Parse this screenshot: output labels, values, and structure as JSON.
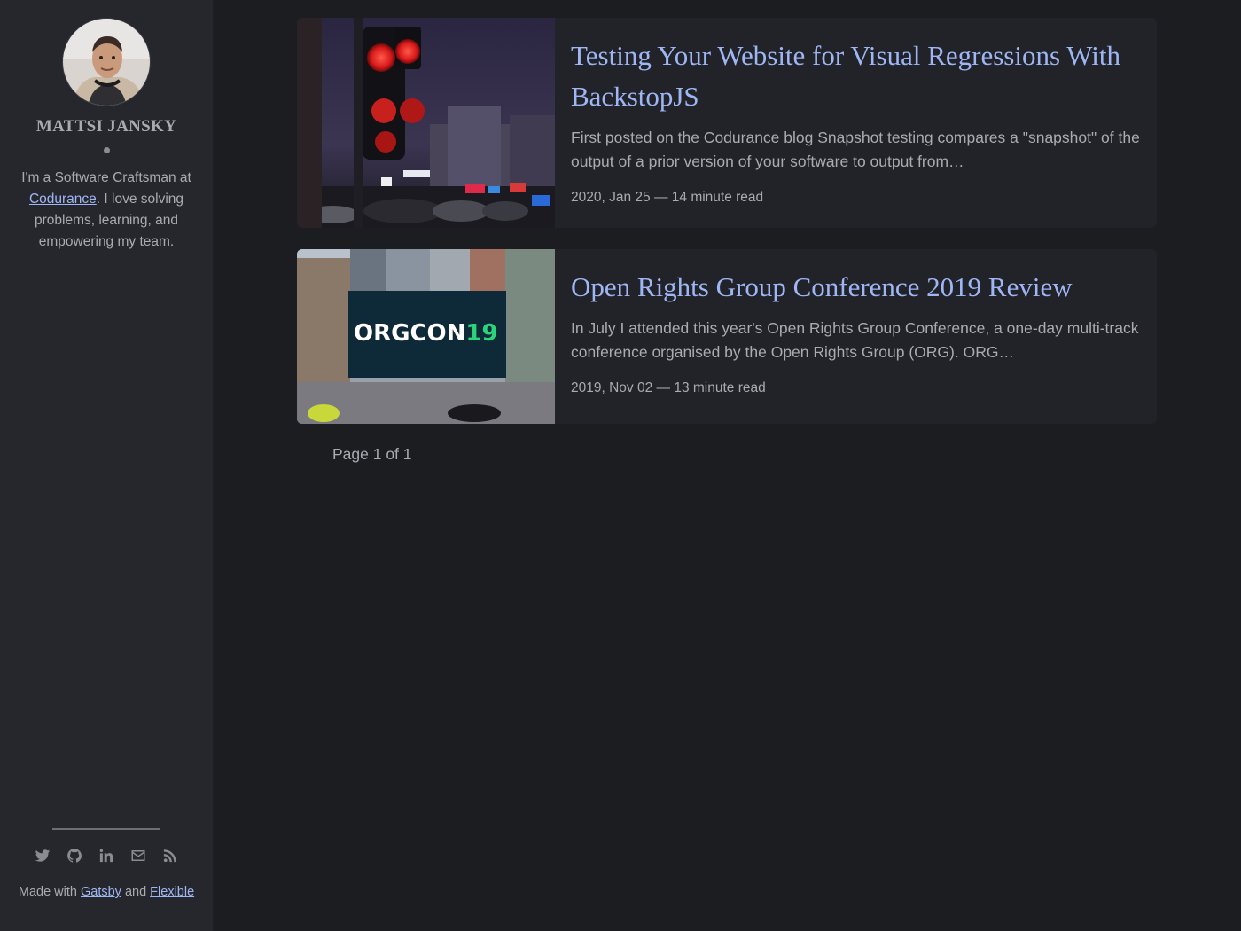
{
  "sidebar": {
    "author_name": "Mattsi Jansky",
    "bio_prefix": "I'm a Software Craftsman at ",
    "bio_link": "Codurance",
    "bio_suffix": ". I love solving problems, learning, and empowering my team.",
    "social_icons": [
      "twitter-icon",
      "github-icon",
      "linkedin-icon",
      "mail-icon",
      "rss-icon"
    ],
    "made_with_prefix": "Made with ",
    "gatsby_label": "Gatsby",
    "and_label": " and ",
    "flexible_label": "Flexible"
  },
  "posts": [
    {
      "title": "Testing Your Website for Visual Regressions With BackstopJS",
      "excerpt": "First posted on the Codurance blog Snapshot testing compares a \"snapshot\" of the output of a prior version of your software to output from…",
      "date": "2020, Jan 25",
      "separator": " — ",
      "read_time": "14 minute read"
    },
    {
      "title": "Open Rights Group Conference 2019 Review",
      "excerpt": "In July I attended this year's Open Rights Group Conference, a one-day multi-track conference organised by the Open Rights Group (ORG). ORG…",
      "date": "2019, Nov 02",
      "separator": " — ",
      "read_time": "13 minute read",
      "image_text": "ORGCON19"
    }
  ],
  "pagination": {
    "label": "Page 1 of 1"
  },
  "colors": {
    "background": "#1b1d21",
    "sidebar": "#25272c",
    "card": "#212328",
    "accent": "#9fb6f5",
    "text": "#a9abb0"
  }
}
